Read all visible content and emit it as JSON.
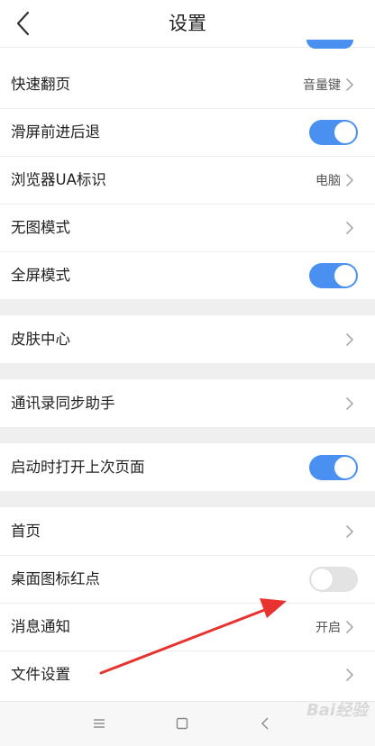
{
  "header": {
    "title": "设置",
    "back_icon": "chevron-left-icon"
  },
  "colors": {
    "accent": "#4a90f0",
    "toggle_off": "#e3e3e3",
    "section_gap": "#efefef",
    "annotation_arrow": "#e8322f"
  },
  "sections": [
    {
      "rows": [
        {
          "label": "快速翻页",
          "type": "value",
          "value": "音量键"
        },
        {
          "label": "滑屏前进后退",
          "type": "toggle",
          "on": true
        },
        {
          "label": "浏览器UA标识",
          "type": "value",
          "value": "电脑"
        },
        {
          "label": "无图模式",
          "type": "chevron"
        },
        {
          "label": "全屏模式",
          "type": "toggle",
          "on": true
        }
      ]
    },
    {
      "rows": [
        {
          "label": "皮肤中心",
          "type": "chevron"
        }
      ]
    },
    {
      "rows": [
        {
          "label": "通讯录同步助手",
          "type": "chevron"
        }
      ]
    },
    {
      "rows": [
        {
          "label": "启动时打开上次页面",
          "type": "toggle",
          "on": true
        }
      ]
    },
    {
      "rows": [
        {
          "label": "首页",
          "type": "chevron"
        },
        {
          "label": "桌面图标红点",
          "type": "toggle",
          "on": false
        },
        {
          "label": "消息通知",
          "type": "value",
          "value": "开启"
        },
        {
          "label": "文件设置",
          "type": "chevron"
        }
      ]
    }
  ],
  "navbar": {
    "items": [
      "menu-icon",
      "home-square-icon",
      "back-triangle-icon"
    ]
  },
  "watermark": "Bai经验"
}
